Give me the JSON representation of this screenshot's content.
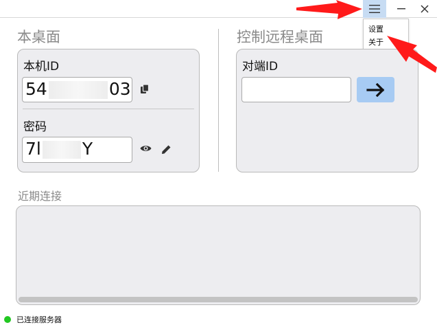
{
  "titlebar": {
    "menu_icon": "hamburger-menu-icon",
    "minimize_icon": "minimize-icon",
    "close_icon": "close-icon"
  },
  "menu": {
    "items": [
      {
        "label": "设置"
      },
      {
        "label": "关于"
      }
    ]
  },
  "local": {
    "heading": "本桌面",
    "id_label": "本机ID",
    "id_prefix": "54",
    "id_suffix": "03",
    "password_label": "密码",
    "password_prefix": "7l",
    "password_suffix": "Y",
    "copy_icon": "copy-icon",
    "eye_icon": "eye-icon",
    "edit_icon": "pencil-icon"
  },
  "remote": {
    "heading": "控制远程桌面",
    "peer_label": "对端ID",
    "peer_value": "",
    "connect_icon": "arrow-right-icon"
  },
  "recent": {
    "heading": "近期连接"
  },
  "status": {
    "text": "已连接服务器",
    "color": "#22c822"
  },
  "colors": {
    "accent_button": "#a7cbf3",
    "menu_active": "#c7dcf3",
    "annotation": "#ff1a1a"
  }
}
